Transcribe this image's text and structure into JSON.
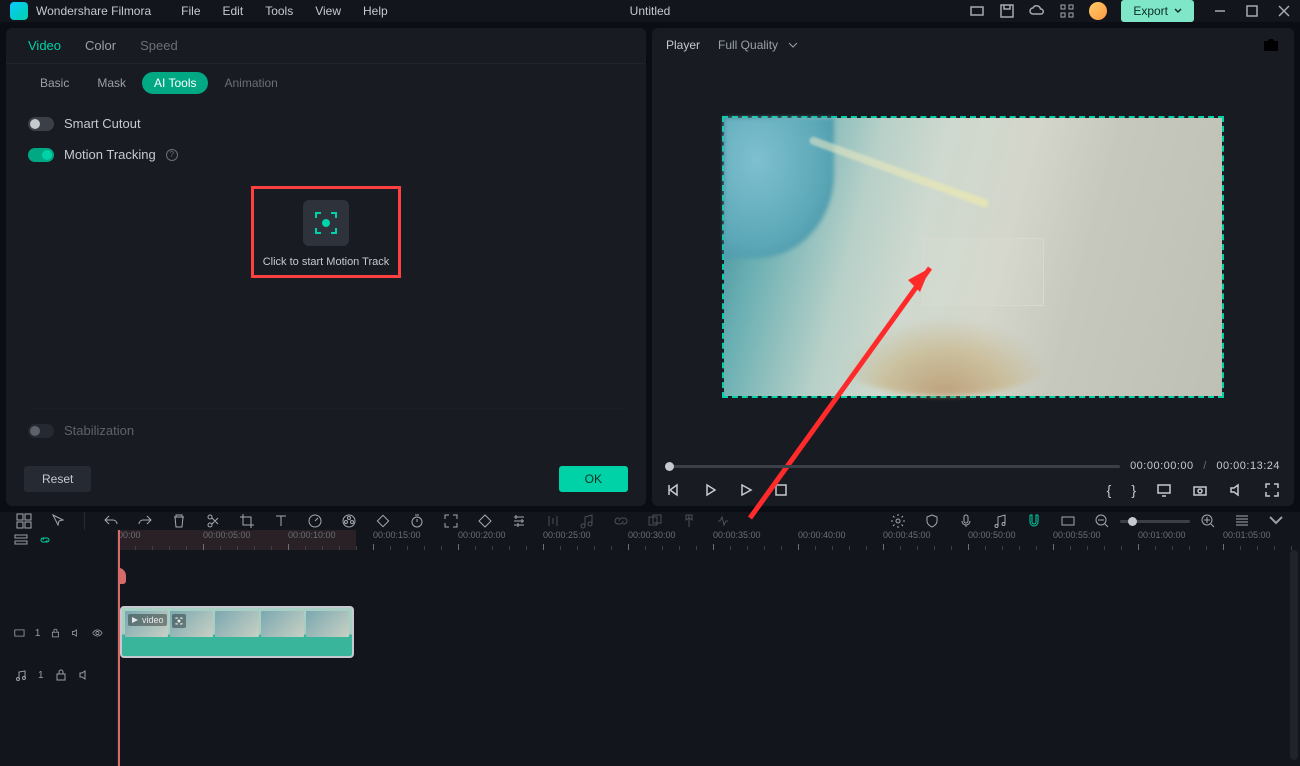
{
  "app": {
    "name": "Wondershare Filmora",
    "doc": "Untitled"
  },
  "menu": {
    "file": "File",
    "edit": "Edit",
    "tools": "Tools",
    "view": "View",
    "help": "Help"
  },
  "titlebar": {
    "export": "Export"
  },
  "leftPanel": {
    "tabsTop": {
      "video": "Video",
      "color": "Color",
      "speed": "Speed"
    },
    "tabsSub": {
      "basic": "Basic",
      "mask": "Mask",
      "aiTools": "AI Tools",
      "animation": "Animation"
    },
    "smartCutout": "Smart Cutout",
    "motionTracking": "Motion Tracking",
    "motionTrackBtn": "Click to start Motion Track",
    "stabilization": "Stabilization",
    "reset": "Reset",
    "ok": "OK"
  },
  "player": {
    "tab": "Player",
    "quality": "Full Quality",
    "cur": "00:00:00:00",
    "sep": "/",
    "dur": "00:00:13:24"
  },
  "timeline": {
    "ticks": [
      "00:00",
      "00:00:05:00",
      "00:00:10:00",
      "00:00:15:00",
      "00:00:20:00",
      "00:00:25:00",
      "00:00:30:00",
      "00:00:35:00",
      "00:00:40:00",
      "00:00:45:00",
      "00:00:50:00",
      "00:00:55:00",
      "00:01:00:00",
      "00:01:05:00"
    ],
    "videoTrack": "1",
    "audioTrack": "1",
    "clipLabel": "video"
  }
}
